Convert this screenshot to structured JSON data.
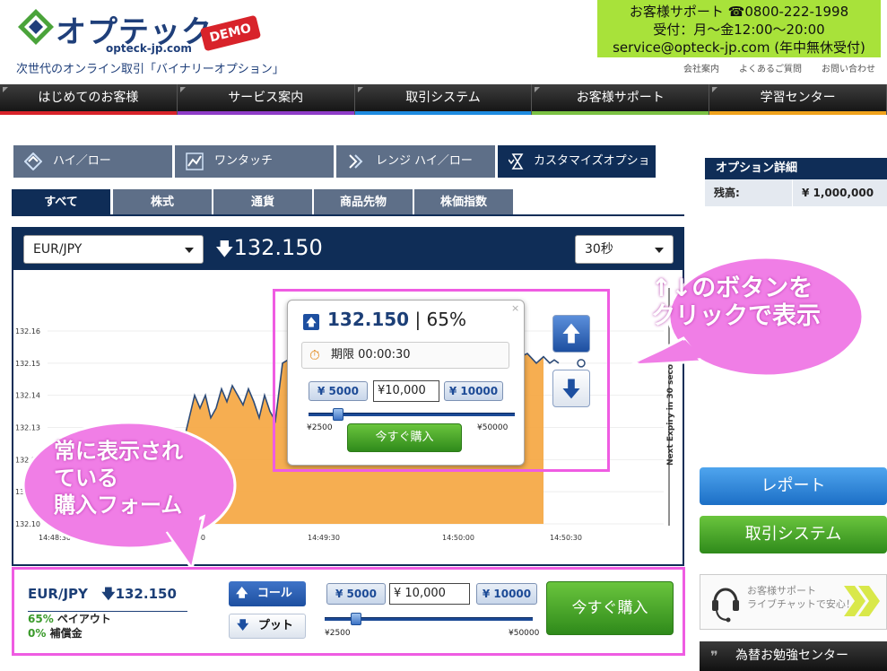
{
  "header": {
    "brand": "オプテック",
    "domain": "opteck-jp.com",
    "demo": "DEMO",
    "tagline": "次世代のオンライン取引「バイナリーオプション」",
    "support": {
      "label": "お客様サポート",
      "phone": "0800-222-1998",
      "hours": "受付：月〜金12:00〜20:00",
      "email": "service@opteck-jp.com (年中無休受付)"
    },
    "links": [
      "会社案内",
      "よくあるご質問",
      "お問い合わせ"
    ]
  },
  "nav": {
    "items": [
      {
        "label": "はじめてのお客様",
        "color": "#d8232a"
      },
      {
        "label": "サービス案内",
        "color": "#8e3cc7"
      },
      {
        "label": "取引システム",
        "color": "#1e8be0"
      },
      {
        "label": "お客様サポート",
        "color": "#7ac142"
      },
      {
        "label": "学習センター",
        "color": "#f0a21b"
      }
    ]
  },
  "product_tabs": [
    "ハイ／ロー",
    "ワンタッチ",
    "レンジ ハイ／ロー",
    "カスタマイズオプション"
  ],
  "category_tabs": [
    "すべて",
    "株式",
    "通貨",
    "商品先物",
    "株価指数"
  ],
  "chart_panel": {
    "pair": "EUR/JPY",
    "price": "132.150",
    "period": "30秒",
    "expiry_label": "Next Expiry in 30 seco"
  },
  "chart_data": {
    "type": "area",
    "y_ticks": [
      "132.16",
      "132.15",
      "132.14",
      "132.13",
      "132.12",
      "132.11",
      "132.10"
    ],
    "x_ticks": [
      "14:48:30",
      "14:49:00",
      "14:49:30",
      "14:50:00",
      "14:50:30"
    ],
    "ylim": [
      132.1,
      132.16
    ],
    "values": [
      132.113,
      132.118,
      132.114,
      132.121,
      132.126,
      132.133,
      132.14,
      132.136,
      132.14,
      132.133,
      132.136,
      132.142,
      132.138,
      132.143,
      132.14,
      132.137,
      132.142,
      132.138,
      132.133,
      132.14,
      132.135,
      132.132,
      132.15,
      132.153,
      132.152,
      132.155,
      132.153,
      132.154,
      132.152,
      132.151,
      132.15,
      132.152,
      132.151,
      132.153,
      132.15,
      132.152,
      132.15,
      132.151,
      132.15
    ],
    "color": "#f5a53e"
  },
  "popup": {
    "price": "132.150",
    "payout": "65%",
    "expiry_label": "期限",
    "expiry_time": "00:00:30",
    "amounts": [
      "¥ 5000",
      "¥ 10000"
    ],
    "amount_value": "¥10,000",
    "min": "¥2500",
    "max": "¥50000",
    "buy": "今すぐ購入",
    "close": "×"
  },
  "callouts": {
    "right": [
      "↑↓のボタンを",
      "クリックで表示"
    ],
    "left": [
      "常に表示され",
      "ている",
      "購入フォーム"
    ]
  },
  "form": {
    "pair": "EUR/JPY",
    "price": "132.150",
    "payout_pct": "65%",
    "payout_label": "ペイアウト",
    "comp_pct": "0%",
    "comp_label": "補償金",
    "call": "コール",
    "put": "プット",
    "amounts": [
      "¥ 5000",
      "¥ 10000"
    ],
    "amount_value": "¥ 10,000",
    "min": "¥2500",
    "max": "¥50000",
    "buy": "今すぐ購入"
  },
  "sidebar": {
    "title": "オプション詳細",
    "balance_label": "残高:",
    "balance": "¥ 1,000,000",
    "report": "レポート",
    "trading": "取引システム",
    "chat1": "お客様サポート",
    "chat2": "ライブチャットで安心！",
    "study": "為替お勉強センター"
  }
}
